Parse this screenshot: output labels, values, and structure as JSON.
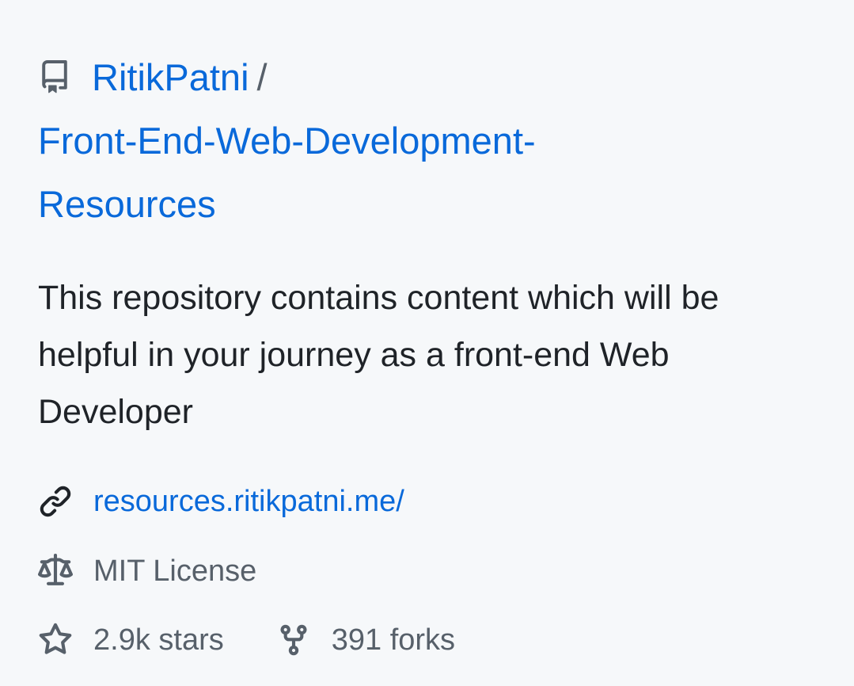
{
  "repo": {
    "owner": "RitikPatni",
    "separator": "/",
    "name": "Front-End-Web-Development-Resources"
  },
  "description": "This repository contains content which will be helpful in your journey as a front-end Web Developer",
  "website": "resources.ritikpatni.me/",
  "license": "MIT License",
  "stats": {
    "stars": "2.9k stars",
    "forks": "391 forks"
  },
  "icons": {
    "repo": "repo-icon",
    "link": "link-icon",
    "license": "law-scale-icon",
    "star": "star-icon",
    "fork": "fork-icon"
  },
  "colors": {
    "background": "#f6f8fa",
    "link": "#0969da",
    "text": "#1f2328",
    "muted": "#57606a"
  }
}
